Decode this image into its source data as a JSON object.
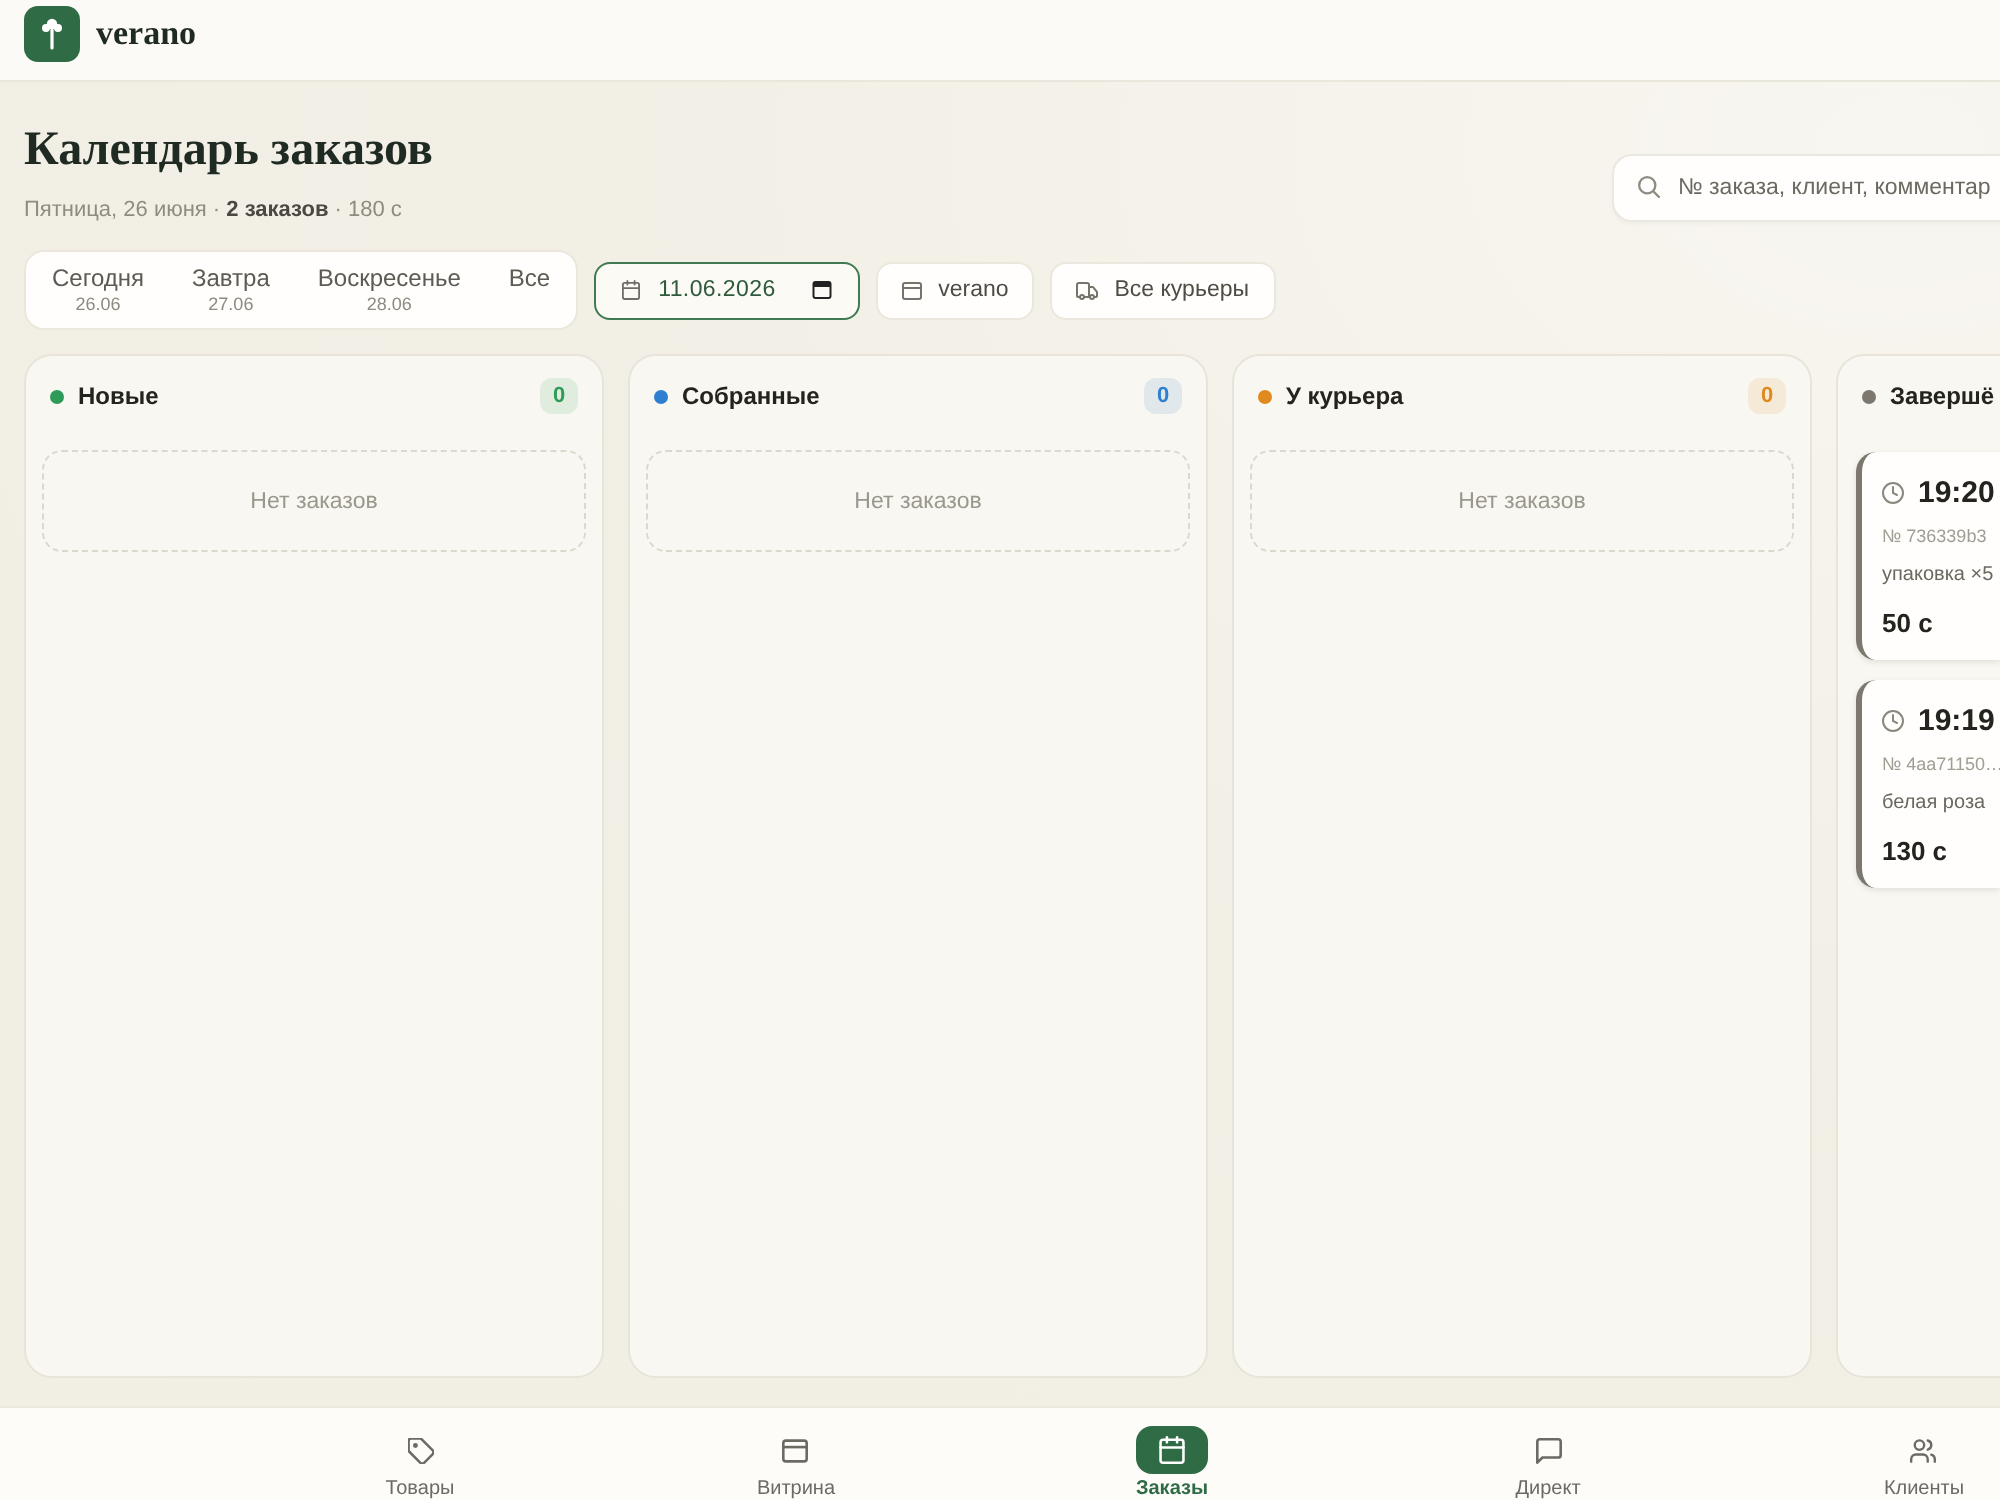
{
  "app": {
    "name": "verano"
  },
  "page": {
    "title": "Календарь заказов",
    "subtitle": "Пятница, 26 июня · **2 заказов** · 180 с"
  },
  "search": {
    "placeholder": "№ заказа, клиент, комментар"
  },
  "day_tabs": [
    {
      "label": "Сегодня",
      "date": "26.06",
      "selected": false
    },
    {
      "label": "Завтра",
      "date": "27.06",
      "selected": false
    },
    {
      "label": "Воскресенье",
      "date": "28.06",
      "selected": false
    },
    {
      "label": "Все",
      "selected": false
    }
  ],
  "date_field": {
    "value": "11.06.2026"
  },
  "filters": [
    {
      "label": "verano"
    },
    {
      "label": "Все курьеры"
    }
  ],
  "columns": [
    {
      "title": "Новые",
      "color": "#2e9b58",
      "count": "0",
      "empty_text": "Нет заказов"
    },
    {
      "title": "Собранные",
      "color": "#2f7fd0",
      "count": "0",
      "empty_text": "Нет заказов"
    },
    {
      "title": "У курьера",
      "color": "#e08a1e",
      "count": "0",
      "empty_text": "Нет заказов"
    },
    {
      "title": "Завершё",
      "color": "#7c786f",
      "orders": [
        {
          "time": "19:20",
          "number": "№ 736339b3",
          "items": "упаковка ×5",
          "total": "50 с"
        },
        {
          "time": "19:19",
          "number": "№ 4aa71150…",
          "items": "белая роза",
          "total": "130 с"
        }
      ]
    }
  ],
  "bottom_nav": [
    {
      "label": "Товары",
      "selected": false
    },
    {
      "label": "Витрина",
      "selected": false
    },
    {
      "label": "Заказы",
      "selected": true
    },
    {
      "label": "Директ",
      "selected": false
    },
    {
      "label": "Клиенты",
      "selected": false
    }
  ]
}
